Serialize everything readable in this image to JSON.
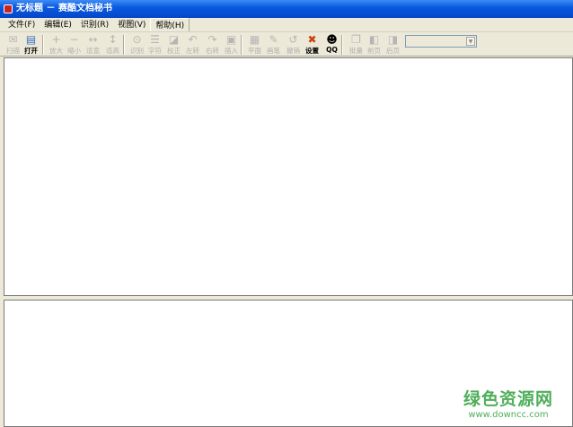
{
  "window": {
    "title": "无标题 － 赛酷文档秘书"
  },
  "menu": [
    "文件(F)",
    "编辑(E)",
    "识别(R)",
    "视图(V)",
    "帮助(H)"
  ],
  "toolbar": [
    {
      "label": "扫描",
      "icon": "scan-icon",
      "enabled": false
    },
    {
      "label": "打开",
      "icon": "open-icon",
      "enabled": true
    },
    {
      "label": "放大",
      "icon": "zoom-in-icon",
      "enabled": false
    },
    {
      "label": "缩小",
      "icon": "zoom-out-icon",
      "enabled": false
    },
    {
      "label": "适宽",
      "icon": "fit-width-icon",
      "enabled": false
    },
    {
      "label": "适高",
      "icon": "fit-height-icon",
      "enabled": false
    },
    {
      "label": "识别",
      "icon": "recognize-icon",
      "enabled": false
    },
    {
      "label": "字符",
      "icon": "text-icon",
      "enabled": false
    },
    {
      "label": "校正",
      "icon": "correct-icon",
      "enabled": false
    },
    {
      "label": "左转",
      "icon": "rotate-left-icon",
      "enabled": false
    },
    {
      "label": "右转",
      "icon": "rotate-right-icon",
      "enabled": false
    },
    {
      "label": "插入",
      "icon": "insert-icon",
      "enabled": false
    },
    {
      "label": "平面",
      "icon": "plane-icon",
      "enabled": false
    },
    {
      "label": "画笔",
      "icon": "pen-icon",
      "enabled": false
    },
    {
      "label": "撤销",
      "icon": "undo-icon",
      "enabled": false
    },
    {
      "label": "设置",
      "icon": "settings-icon",
      "enabled": true
    },
    {
      "label": "QQ",
      "icon": "qq-icon",
      "enabled": true
    },
    {
      "label": "批量",
      "icon": "batch-icon",
      "enabled": false
    },
    {
      "label": "前页",
      "icon": "prev-page-icon",
      "enabled": false
    },
    {
      "label": "后页",
      "icon": "next-page-icon",
      "enabled": false
    }
  ],
  "combo": {
    "value": ""
  },
  "watermark": {
    "name": "绿色资源网",
    "url": "www.downcc.com"
  }
}
